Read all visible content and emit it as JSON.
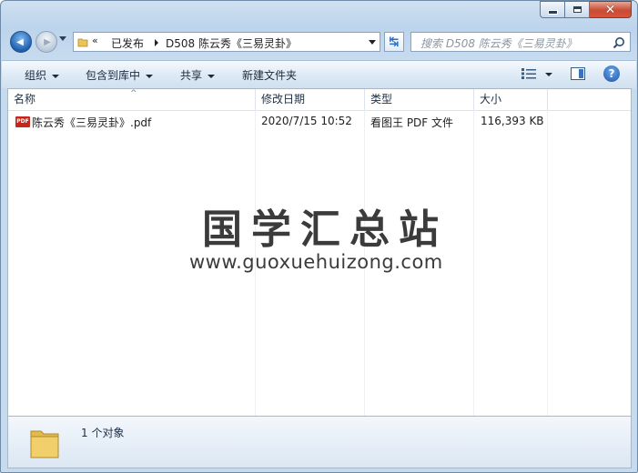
{
  "window": {
    "controls": {
      "minimize_icon": "minimize-icon",
      "maximize_icon": "maximize-icon",
      "close_icon": "close-icon",
      "close_glyph": "✕"
    }
  },
  "nav": {
    "back_glyph": "◀",
    "forward_glyph": "▶",
    "address": {
      "chevron": "«",
      "crumbs": [
        "已发布",
        "D508 陈云秀《三易灵卦》"
      ]
    },
    "refresh_glyph": "↹",
    "search": {
      "placeholder": "搜索 D508 陈云秀《三易灵卦》"
    }
  },
  "toolbar": {
    "organize": "组织",
    "include_in_library": "包含到库中",
    "share": "共享",
    "new_folder": "新建文件夹",
    "help_glyph": "?"
  },
  "columns": [
    "名称",
    "修改日期",
    "类型",
    "大小"
  ],
  "files": [
    {
      "icon": "pdf-file-icon",
      "icon_label": "PDF",
      "name": "陈云秀《三易灵卦》.pdf",
      "modified": "2020/7/15 10:52",
      "type": "看图王 PDF 文件",
      "size": "116,393 KB"
    }
  ],
  "watermark": {
    "title": "国学汇总站",
    "url": "www.guoxuehuizong.com"
  },
  "details": {
    "summary": "1 个对象"
  },
  "colors": {
    "frame": "#bcd4ec",
    "accent": "#1f5fae",
    "pdf_red": "#c9261b"
  }
}
